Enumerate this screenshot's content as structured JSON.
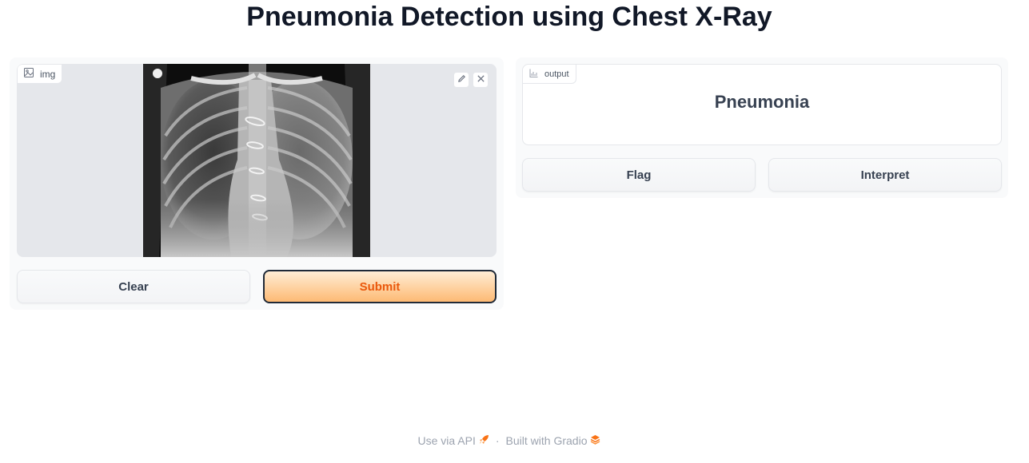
{
  "app": {
    "title": "Pneumonia Detection using Chest X-Ray"
  },
  "input": {
    "label": "img",
    "label_icon": "image-icon",
    "image_description": "chest x-ray",
    "edit_icon": "pencil-icon",
    "close_icon": "close-icon",
    "clear_label": "Clear",
    "submit_label": "Submit"
  },
  "output": {
    "label": "output",
    "label_icon": "bar-chart-icon",
    "value": "Pneumonia",
    "flag_label": "Flag",
    "interpret_label": "Interpret"
  },
  "footer": {
    "api_label": "Use via API",
    "api_icon": "rocket-icon",
    "separator": "·",
    "built_label": "Built with Gradio",
    "gradio_icon": "gradio-logo-icon"
  },
  "colors": {
    "accent": "#ea580c",
    "submit_gradient_start": "#ffedd5",
    "submit_gradient_end": "#fdba74"
  }
}
